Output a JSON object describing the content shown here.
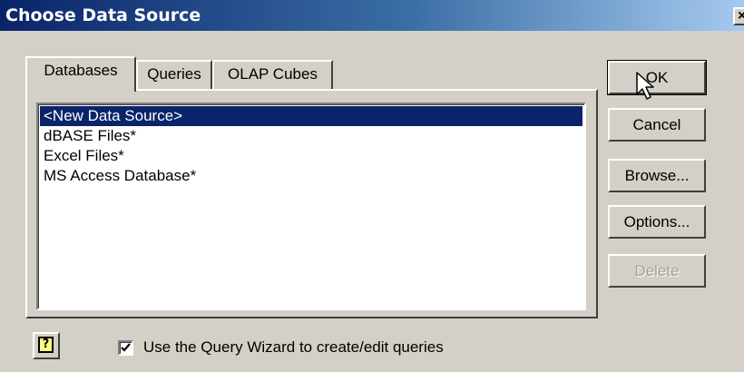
{
  "window": {
    "title": "Choose Data Source",
    "close_label": "×"
  },
  "tabs": [
    {
      "label": "Databases",
      "active": true
    },
    {
      "label": "Queries",
      "active": false
    },
    {
      "label": "OLAP Cubes",
      "active": false
    }
  ],
  "list": {
    "items": [
      {
        "label": "<New Data Source>",
        "selected": true
      },
      {
        "label": "dBASE Files*",
        "selected": false
      },
      {
        "label": "Excel Files*",
        "selected": false
      },
      {
        "label": "MS Access Database*",
        "selected": false
      }
    ]
  },
  "buttons": {
    "ok": "OK",
    "cancel": "Cancel",
    "browse": "Browse...",
    "options": "Options...",
    "delete": "Delete"
  },
  "help": {
    "icon": "help-icon",
    "glyph": "?"
  },
  "wizard": {
    "label": "Use the Query Wizard to create/edit queries",
    "checked": true
  },
  "colors": {
    "titlebar_start": "#0a246a",
    "titlebar_end": "#a6caf0",
    "selection": "#0a246a",
    "face": "#d4d0c8"
  }
}
